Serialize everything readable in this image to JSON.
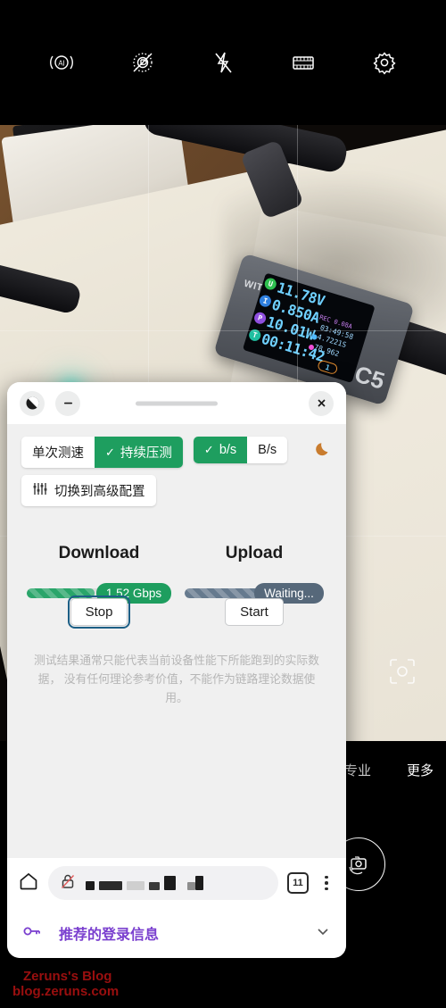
{
  "camera": {
    "toolbar": [
      {
        "name": "ai-scene-icon",
        "label": "AI"
      },
      {
        "name": "watermark-off-icon",
        "label": ""
      },
      {
        "name": "flash-off-icon",
        "label": ""
      },
      {
        "name": "film-filter-icon",
        "label": ""
      },
      {
        "name": "settings-gear-icon",
        "label": ""
      }
    ],
    "modes": [
      {
        "label": "专业",
        "active": false
      },
      {
        "label": "更多",
        "active": true
      }
    ],
    "scan_icon": "focus-reticle-icon",
    "shutter_icon": "camera-switch-icon"
  },
  "photo": {
    "device_brand": "WITRN",
    "device_model": "C5",
    "readout": {
      "voltage": "11.78V",
      "current": "0.850A",
      "power": "10.01W",
      "time": "00:11:42",
      "rec": "REC 0.08A",
      "elapsed": "03:49:58",
      "capacity": "4.7221S",
      "energy": "78.962",
      "port": "1",
      "badges": [
        "U",
        "I",
        "P",
        "T"
      ]
    }
  },
  "panel": {
    "header": {
      "theme_button": "contrast-toggle",
      "minimize_button": "minimize",
      "close_button": "close"
    },
    "segments": {
      "mode": [
        {
          "label": "单次测速",
          "selected": false
        },
        {
          "label": "持续压测",
          "selected": true
        }
      ],
      "unit": [
        {
          "label": "b/s",
          "selected": true
        },
        {
          "label": "B/s",
          "selected": false
        }
      ],
      "check_glyph": "✓",
      "moon_icon": "moon-icon",
      "advanced_label": "切换到高级配置",
      "advanced_icon": "sliders-icon"
    },
    "download": {
      "title": "Download",
      "value": "1.52 Gbps",
      "button": "Stop",
      "progress_pct": 88,
      "bar_color": "#2aa56a",
      "pill_color": "#1e9e5f",
      "button_focused": true
    },
    "upload": {
      "title": "Upload",
      "value": "Waiting...",
      "button": "Start",
      "progress_pct": 100,
      "bar_color": "#667a8e",
      "pill_color": "#56687a",
      "button_focused": false
    },
    "disclaimer": "测试结果通常只能代表当前设备性能下所能跑到的实际数据， 没有任何理论参考价值，不能作为链路理论数据使用。"
  },
  "browser": {
    "home_icon": "home-icon",
    "security_icon": "lock-crossed-icon",
    "url_redacted": true,
    "tab_count": "11",
    "menu_icon": "kebab-menu-icon"
  },
  "login_suggestion": {
    "icon": "key-icon",
    "label": "推荐的登录信息",
    "chevron": "chevron-down-icon",
    "accent": "#7a3fcf"
  },
  "watermark": {
    "line1": "Zeruns's Blog",
    "line2": "blog.zeruns.com",
    "color": "#9a0f0f"
  }
}
